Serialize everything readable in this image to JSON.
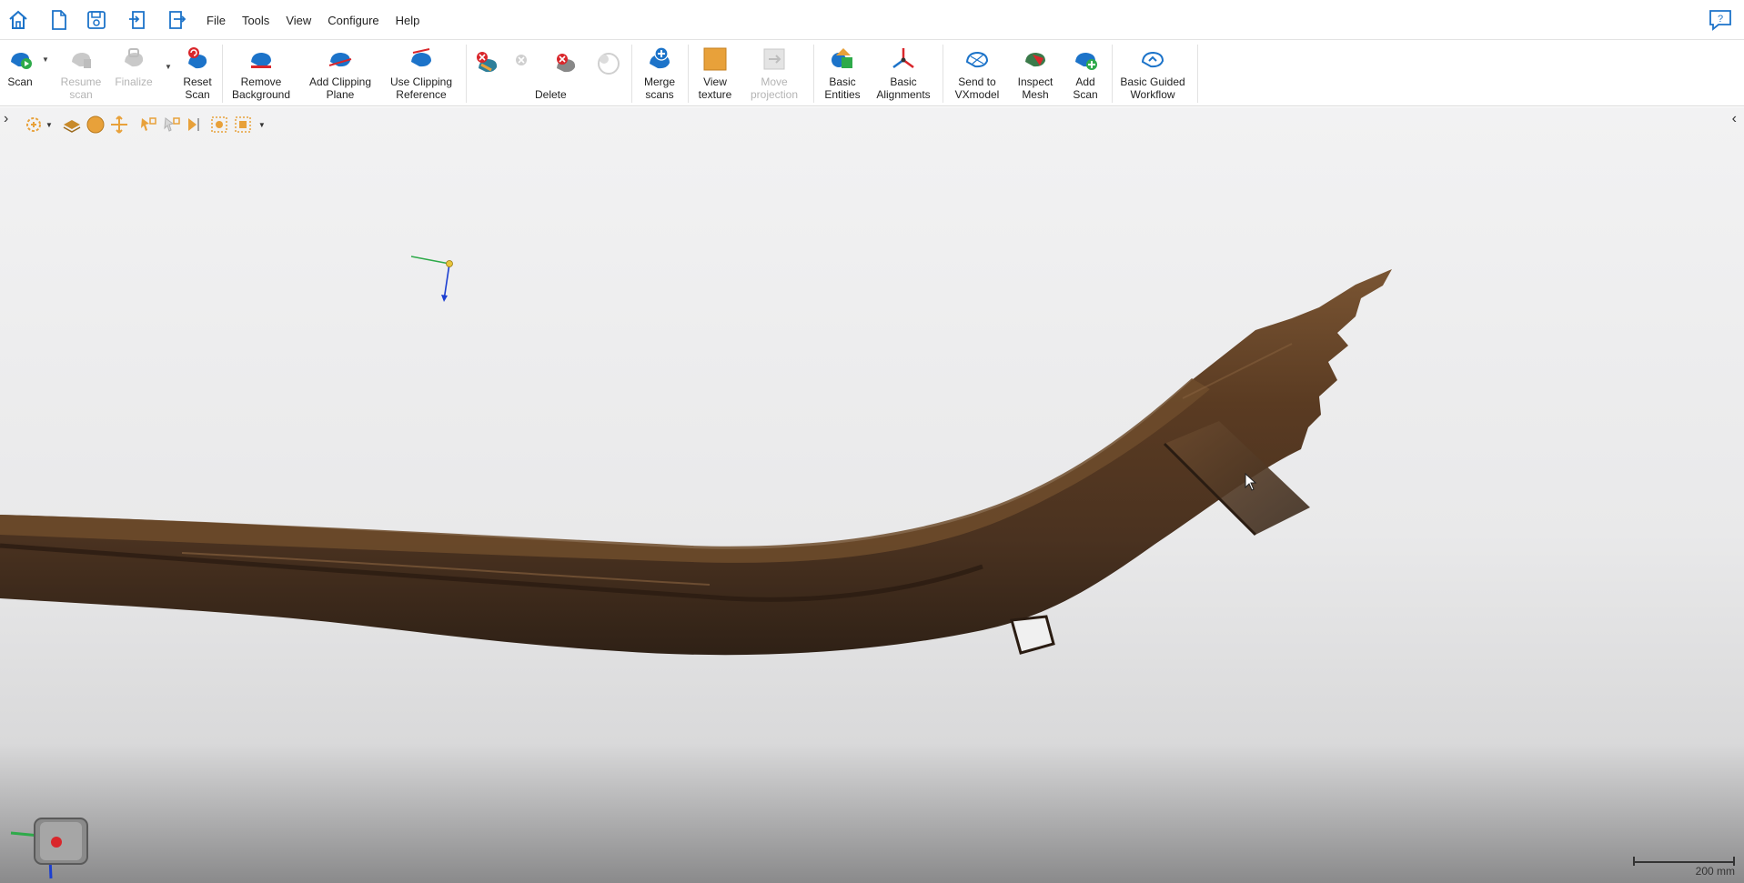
{
  "menu": {
    "items": [
      "File",
      "Tools",
      "View",
      "Configure",
      "Help"
    ]
  },
  "ribbon": {
    "scan": "Scan",
    "resume_scan": "Resume\nscan",
    "finalize": "Finalize",
    "reset_scan": "Reset\nScan",
    "remove_background": "Remove\nBackground",
    "add_clipping_plane": "Add Clipping\nPlane",
    "use_clipping_reference": "Use Clipping\nReference",
    "delete_group": "Delete",
    "merge_scans": "Merge\nscans",
    "view_texture": "View\ntexture",
    "move_projection": "Move\nprojection",
    "basic_entities": "Basic\nEntities",
    "basic_alignments": "Basic\nAlignments",
    "send_to_vxmodel": "Send to\nVXmodel",
    "inspect_mesh": "Inspect\nMesh",
    "add_scan": "Add\nScan",
    "basic_guided_workflow": "Basic Guided\nWorkflow"
  },
  "viewport": {
    "scale_label": "200 mm",
    "icons": [
      "selection-mode-icon",
      "layers-icon",
      "sphere-icon",
      "move-icon",
      "select-all-icon",
      "invert-selection-icon",
      "select-through-icon",
      "lasso-select-icon",
      "rect-select-icon"
    ]
  },
  "colors": {
    "accent_blue": "#1c73c9",
    "delete_red": "#d9262b",
    "texture_orange": "#e8a13a",
    "wood_dark": "#3d2a1c",
    "wood_mid": "#6b4a2e"
  }
}
